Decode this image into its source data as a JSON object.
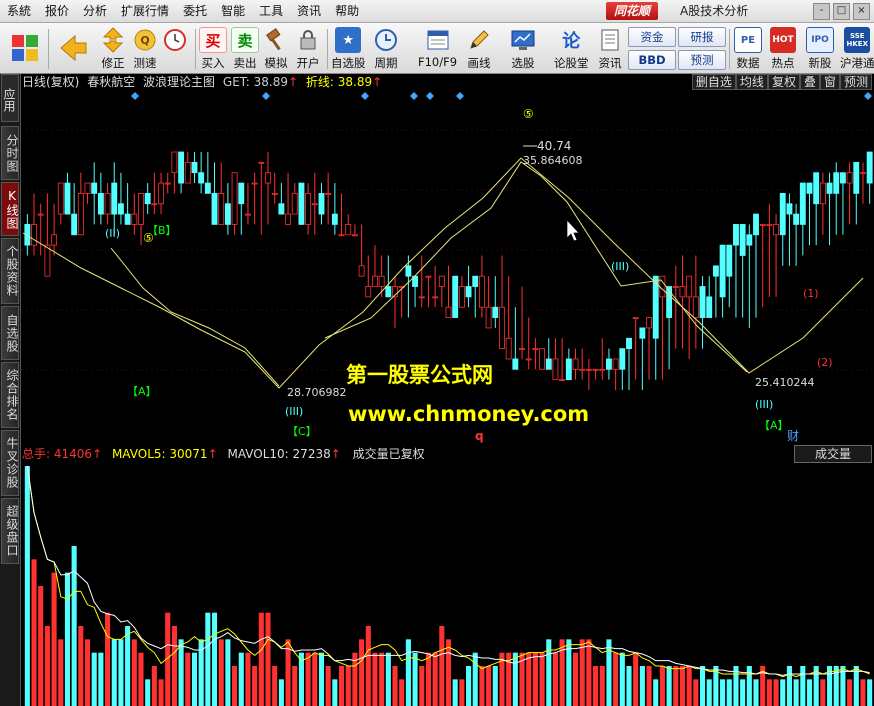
{
  "menu": [
    "系統",
    "报价",
    "分析",
    "扩展行情",
    "委托",
    "智能",
    "工具",
    "资讯",
    "帮助"
  ],
  "brand": "同花顺",
  "app_title": "A股技术分析",
  "window_buttons": [
    "-",
    "□",
    "×"
  ],
  "toolbar": {
    "buttons": [
      {
        "label": "修正",
        "icon": "up-down-arrows-icon"
      },
      {
        "label": "测速",
        "icon": "speed-icon"
      },
      {
        "label": "买入",
        "icon": "buy-icon",
        "glyph": "买"
      },
      {
        "label": "卖出",
        "icon": "sell-icon",
        "glyph": "卖"
      },
      {
        "label": "模拟",
        "icon": "gavel-icon"
      },
      {
        "label": "开户",
        "icon": "lock-icon"
      },
      {
        "label": "自选股",
        "icon": "star-icon"
      },
      {
        "label": "周期",
        "icon": "clock-icon"
      },
      {
        "label": "F10/F9",
        "icon": "f10-icon"
      },
      {
        "label": "画线",
        "icon": "pencil-icon"
      },
      {
        "label": "选股",
        "icon": "screen-icon"
      },
      {
        "label": "论股堂",
        "icon": "lun-icon",
        "glyph": "论"
      },
      {
        "label": "资讯",
        "icon": "news-icon"
      },
      {
        "label": "数据",
        "icon": "pe-icon",
        "glyph": "PE"
      },
      {
        "label": "热点",
        "icon": "hot-icon"
      },
      {
        "label": "新股",
        "icon": "ipo-icon"
      },
      {
        "label": "沪港通",
        "icon": "sse-hkex-icon",
        "glyph": "SSE HKEX"
      }
    ],
    "small_buttons": [
      "资金",
      "研报",
      "BBD",
      "预测"
    ]
  },
  "sidebar": {
    "top": "应用",
    "tabs": [
      "分时图",
      "K线图",
      "个股资料",
      "自选股",
      "综合排名",
      "牛叉诊股",
      "超级盘口"
    ],
    "active": "K线图"
  },
  "chart": {
    "period": "日线(复权)",
    "stock_name": "春秋航空",
    "indicator": "波浪理论主图",
    "get_label": "GET:",
    "get_value": "38.89",
    "zx_label": "折线:",
    "zx_value": "38.89",
    "right_buttons": [
      "删自选",
      "均线",
      "复权",
      "叠",
      "窗",
      "预测"
    ],
    "price_high_label": "40.74",
    "high_value": "35.864608",
    "low_left_value": "28.706982",
    "low_right_value": "25.410244",
    "wave_labels": [
      "(II)",
      "【B】",
      "【A】",
      "【C】",
      "(III)",
      "(III)",
      "【A】",
      "(1)",
      "(2)",
      "(III)"
    ],
    "circle_labels": [
      "⑤",
      "⑤"
    ],
    "markers": [
      "q",
      "财"
    ],
    "watermark_line1": "第一股票公式网",
    "watermark_line2": "www.chnmoney.com",
    "colors": {
      "up": "#ff3232",
      "down": "#54ffff",
      "wave": "#e6e67a",
      "yellow": "#ffff00",
      "green": "#00ff00",
      "diamond": "#3fa7ff"
    }
  },
  "volume": {
    "total_label": "总手:",
    "total_value": "41406",
    "mavol5_label": "MAVOL5:",
    "mavol5_value": "30071",
    "mavol10_label": "MAVOL10:",
    "mavol10_value": "27238",
    "note": "成交量已复权",
    "tab": "成交量"
  },
  "chart_data": {
    "type": "candlestick",
    "open": "sqtnqtwtrvwvtwutssvuuwxzwyxwvsuswtwywvustwsuvvtrrrnlmmmlmonlnlmjnkmnkikgffgfgefddfeeeeefeghjiinlmmlljmloqqssrtssrvutwwxuwxxwyxz",
    "close": "qstqrwtrvwvtvttstvuuwwzwyxwvsvsxutwyxvttvsvutvsrsromnnlmmnmlnlnkjmlmnkjkhegfggefddfeeeeefegjhjhnjmmnljjnlnqpqrsssrtssvuwvvwxvxwxwzzxy",
    "high": "tvuvutxwxwyxwyxwvuwxxxzzzzzzyywvvwxvzxwxwvwxwxwvtsspqppnmpnpmononnokpnnpnkmjhghhhgggfehgfgfghilkkopnpnnkmppqstsutuvuwvwxxywyyyzzz",
    "low": "ppprpstrtusssrssrqtttvvvwwvwutrrrssrsuvsusrrssrssrpoollijjkkkkkkkkkjjjiihffeeeeeedddcdddcccdcdddeggfggjjjkjjijkllooopqqrqrrssuustuuuvuwwxx",
    "volume": "sljgkfkmgfeehffgfecdchgfeefhhffdeedhhdcfdeeeedcddefgeeedcfedeegfccdedddeeeeeeefeffeffddfeededdcdddddcdcdccdcdcdcccdcdcdcdddcdcc",
    "note": "approximate encoded OHLC/volume series (base-letter offsets), plotted left to right"
  }
}
